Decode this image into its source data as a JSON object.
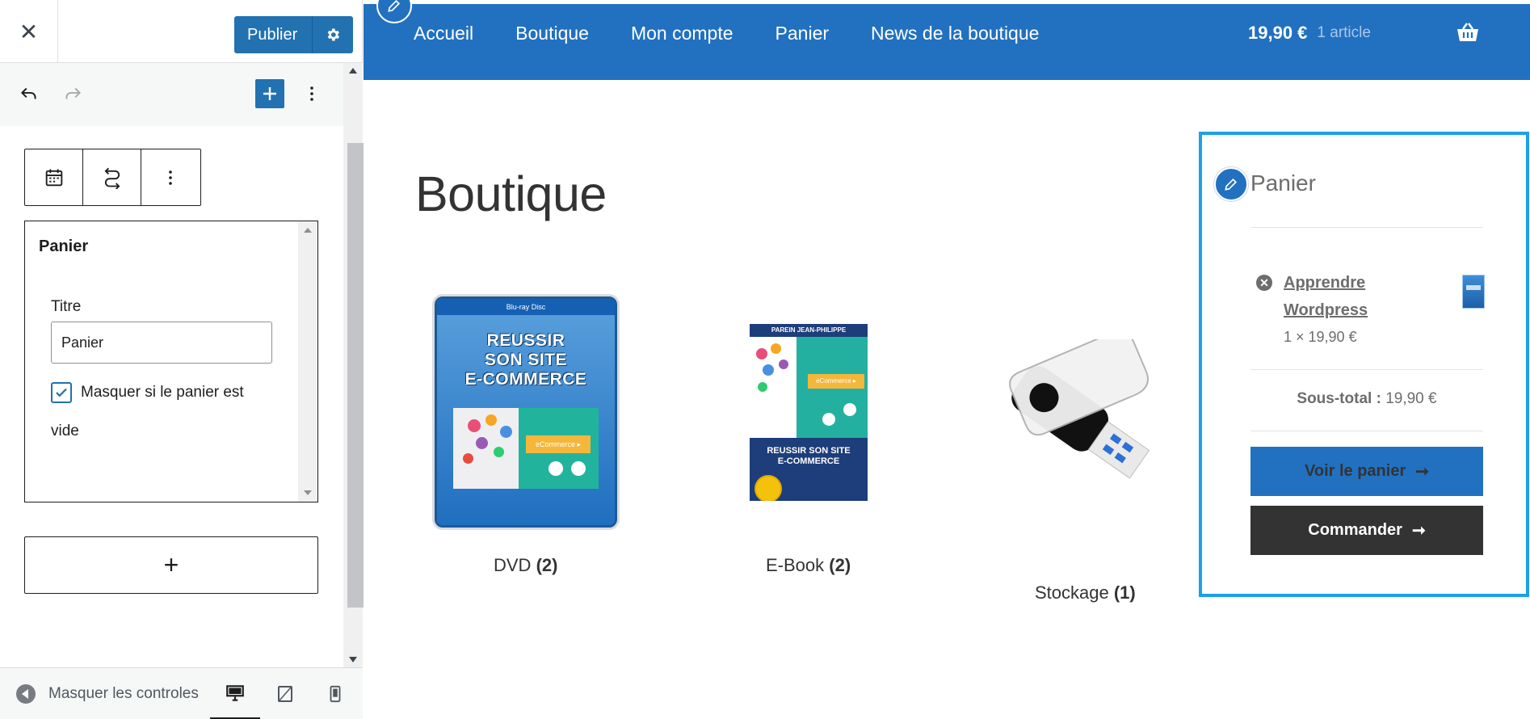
{
  "sidebar": {
    "close_symbol": "✕",
    "publish_label": "Publier",
    "icons": {
      "close": "close-icon",
      "settings": "gear-icon",
      "undo": "undo-icon",
      "redo": "redo-icon",
      "add": "plus-icon",
      "options": "vertical-ellipsis-icon",
      "calendar": "calendar-icon",
      "transform": "transform-icon"
    },
    "widget_panel": {
      "title": "Panier",
      "field_label": "Titre",
      "field_value": "Panier",
      "checkbox_label": "Masquer si le panier est vide",
      "checkbox_checked": true
    },
    "add_block_symbol": "+",
    "footer": {
      "hide_controls": "Masquer les controles",
      "devices": [
        "desktop",
        "tablet",
        "mobile"
      ],
      "active_device": "desktop"
    }
  },
  "site": {
    "nav": [
      "Accueil",
      "Boutique",
      "Mon compte",
      "Panier",
      "News de la boutique"
    ],
    "cart_amount": "19,90 €",
    "cart_count": "1 article",
    "page_title": "Boutique",
    "products": [
      {
        "name": "DVD",
        "count": "(2)",
        "image": "dvd-cover",
        "cover_text": [
          "REUSSIR",
          "SON SITE",
          "E-COMMERCE"
        ]
      },
      {
        "name": "E-Book",
        "count": "(2)",
        "image": "ebook-cover",
        "cover_author": "PAREIN JEAN-PHILIPPE",
        "cover_text": [
          "REUSSIR SON SITE",
          "E-COMMERCE"
        ]
      },
      {
        "name": "Stockage",
        "count": "(1)",
        "image": "usb-drive"
      }
    ],
    "widget": {
      "heading": "Panier",
      "item_name": "Apprendre Wordpress",
      "item_qty": "1 × 19,90 €",
      "subtotal_label": "Sous-total :",
      "subtotal_value": "19,90 €",
      "view_cart": "Voir le panier",
      "checkout": "Commander",
      "remove_symbol": "✕"
    }
  },
  "colors": {
    "header_blue": "#2271c0",
    "wp_blue": "#2271b1",
    "widget_highlight": "#1aa1e6",
    "checkout_dark": "#333333"
  }
}
